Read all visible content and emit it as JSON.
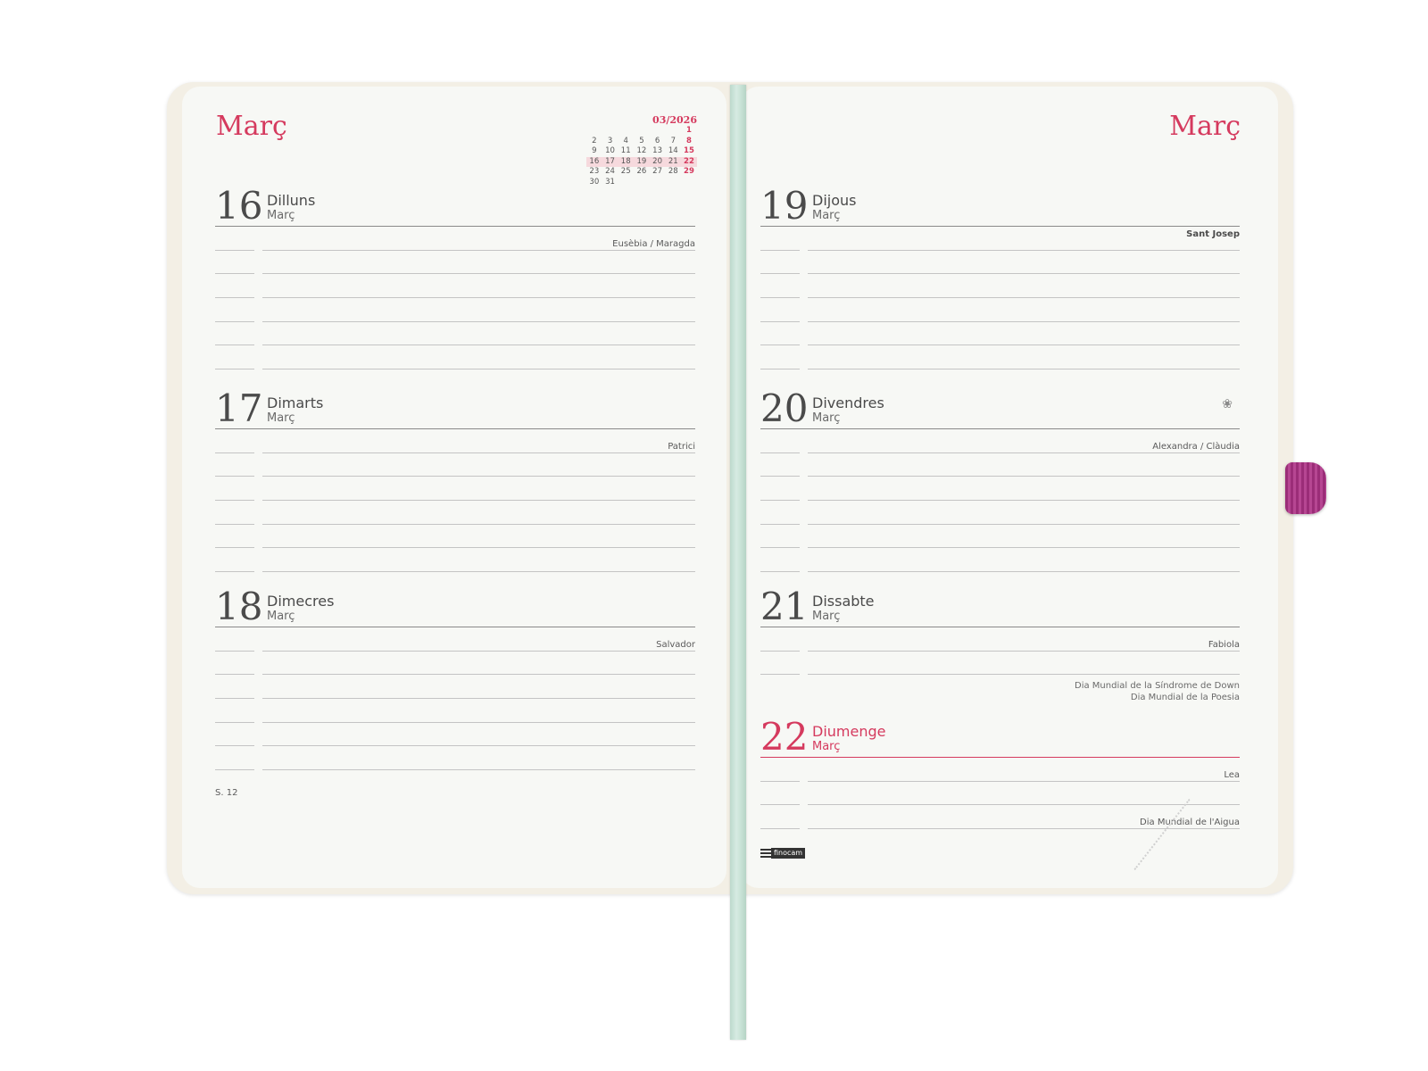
{
  "left_page": {
    "month_title": "Març",
    "mini_calendar": {
      "header": "03/2026",
      "rows": [
        [
          "",
          "",
          "",
          "",
          "",
          "",
          "1"
        ],
        [
          "2",
          "3",
          "4",
          "5",
          "6",
          "7",
          "8"
        ],
        [
          "9",
          "10",
          "11",
          "12",
          "13",
          "14",
          "15"
        ],
        [
          "16",
          "17",
          "18",
          "19",
          "20",
          "21",
          "22"
        ],
        [
          "23",
          "24",
          "25",
          "26",
          "27",
          "28",
          "29"
        ],
        [
          "30",
          "31",
          "",
          "",
          "",
          "",
          ""
        ]
      ],
      "highlighted_week_index": 3
    },
    "days": [
      {
        "number": "16",
        "name": "Dilluns",
        "month": "Març",
        "saint": "Eusèbia / Maragda"
      },
      {
        "number": "17",
        "name": "Dimarts",
        "month": "Març",
        "saint": "Patrici"
      },
      {
        "number": "18",
        "name": "Dimecres",
        "month": "Març",
        "saint": "Salvador"
      }
    ],
    "week_label": "S. 12"
  },
  "right_page": {
    "month_title": "Març",
    "days": [
      {
        "number": "19",
        "name": "Dijous",
        "month": "Març",
        "saint": "Sant Josep"
      },
      {
        "number": "20",
        "name": "Divendres",
        "month": "Març",
        "saint": "Alexandra / Clàudia",
        "icon": "flower-icon"
      },
      {
        "number": "21",
        "name": "Dissabte",
        "month": "Març",
        "saint": "Fabiola",
        "events": [
          "Dia Mundial de la Síndrome de Down",
          "Dia Mundial de la Poesia"
        ]
      },
      {
        "number": "22",
        "name": "Diumenge",
        "month": "Març",
        "saint": "Lea",
        "events": [
          "Dia Mundial de l'Aigua"
        ]
      }
    ],
    "brand": "finocam"
  },
  "colors": {
    "accent": "#d53a5e",
    "ribbon": "#c7e1d5",
    "elastic": "#a63a85",
    "cover": "#f3efe5",
    "paper": "#f7f8f5"
  }
}
